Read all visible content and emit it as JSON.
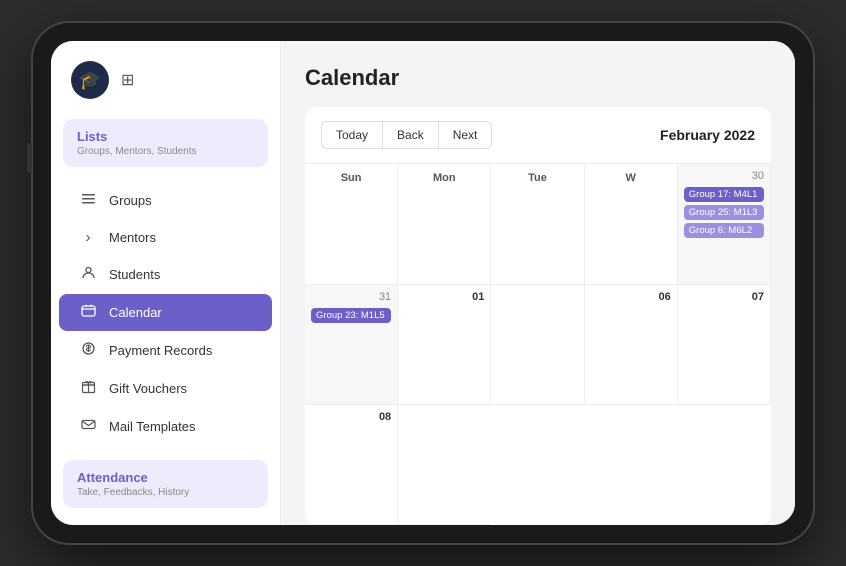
{
  "sidebar": {
    "logo_icon": "🎓",
    "filter_icon": "⊞",
    "lists_section": {
      "title": "Lists",
      "subtitle": "Groups, Mentors, Students"
    },
    "nav_items": [
      {
        "id": "groups",
        "label": "Groups",
        "icon": "≡"
      },
      {
        "id": "mentors",
        "label": "Mentors",
        "icon": "›"
      },
      {
        "id": "students",
        "label": "Students",
        "icon": "👤"
      },
      {
        "id": "calendar",
        "label": "Calendar",
        "icon": "📅",
        "active": true
      },
      {
        "id": "payment-records",
        "label": "Payment Records",
        "icon": "$"
      },
      {
        "id": "gift-vouchers",
        "label": "Gift Vouchers",
        "icon": "🎁"
      },
      {
        "id": "mail-templates",
        "label": "Mail Templates",
        "icon": "✉"
      }
    ],
    "attendance_section": {
      "title": "Attendance",
      "subtitle": "Take, Feedbacks, History"
    }
  },
  "main": {
    "page_title": "Calendar",
    "toolbar": {
      "today_label": "Today",
      "back_label": "Back",
      "next_label": "Next",
      "month_label": "February 2022"
    },
    "calendar": {
      "headers": [
        "Sun",
        "Mon",
        "Tue",
        "W"
      ],
      "week1": [
        {
          "date": "30",
          "prev": true,
          "events": [
            {
              "label": "Group 17: M4L1",
              "color": "purple"
            },
            {
              "label": "Group 25: M1L3",
              "color": "light-purple"
            },
            {
              "label": "Group 6: M6L2",
              "color": "light-purple"
            }
          ]
        },
        {
          "date": "31",
          "prev": true,
          "events": [
            {
              "label": "Group 23: M1L5",
              "color": "purple"
            }
          ]
        },
        {
          "date": "01",
          "prev": false,
          "events": []
        },
        {
          "date": "",
          "prev": false,
          "events": []
        }
      ],
      "week2": [
        {
          "date": "06",
          "prev": false,
          "events": []
        },
        {
          "date": "07",
          "prev": false,
          "events": []
        },
        {
          "date": "08",
          "prev": false,
          "events": []
        },
        {
          "date": "",
          "prev": false,
          "events": []
        }
      ]
    }
  }
}
